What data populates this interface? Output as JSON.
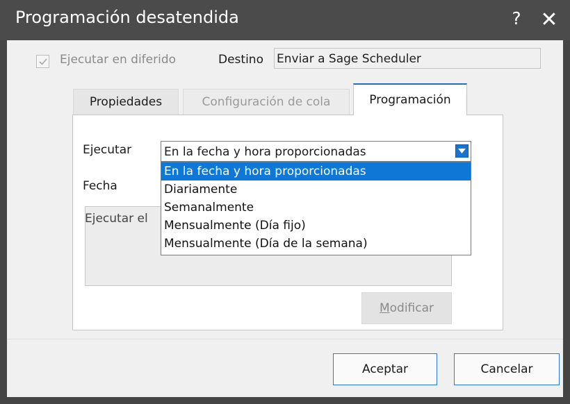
{
  "window": {
    "title": "Programación desatendida",
    "help_label": "?",
    "close_label": "✕"
  },
  "options": {
    "deferred_label": "Ejecutar en diferido",
    "deferred_checked": true,
    "destination_label": "Destino",
    "destination_value": "Enviar a Sage Scheduler"
  },
  "tabs": [
    {
      "label": "Propiedades",
      "state": "normal"
    },
    {
      "label": "Configuración de cola",
      "state": "disabled"
    },
    {
      "label": "Programación",
      "state": "active"
    }
  ],
  "schedule": {
    "run_label": "Ejecutar",
    "run_value": "En la fecha y hora proporcionadas",
    "date_label": "Fecha",
    "summary_text": "Ejecutar el",
    "dropdown_options": [
      "En la fecha y hora proporcionadas",
      "Diariamente",
      "Semanalmente",
      "Mensualmente (Día fijo)",
      "Mensualmente (Día de la semana)"
    ],
    "modify_button": {
      "accel": "M",
      "rest": "odificar"
    }
  },
  "footer": {
    "ok_label": "Aceptar",
    "cancel_label": "Cancelar"
  },
  "colors": {
    "accent": "#1874d2",
    "selection": "#0f78d7",
    "titlebar": "#4b4b4b"
  }
}
